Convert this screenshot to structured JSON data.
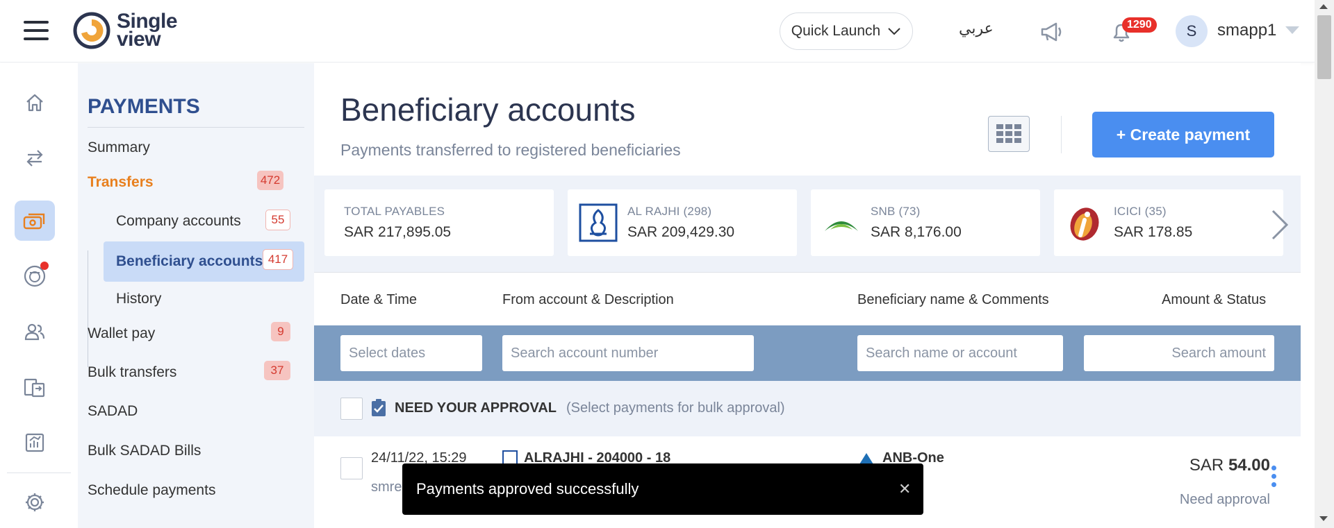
{
  "header": {
    "logo_line1": "Single",
    "logo_line2": "view",
    "quick_launch": "Quick Launch",
    "language": "عربي",
    "notifications_count": "1290",
    "avatar_initial": "S",
    "username": "smapp1"
  },
  "rail": {
    "items": [
      "home",
      "transfers",
      "payments",
      "savings",
      "users",
      "documents",
      "reports",
      "settings"
    ],
    "active": "payments"
  },
  "sidebar": {
    "title": "PAYMENTS",
    "summary": "Summary",
    "transfers": {
      "label": "Transfers",
      "badge": "472"
    },
    "company_accounts": {
      "label": "Company accounts",
      "badge": "55"
    },
    "beneficiary_accounts": {
      "label": "Beneficiary accounts",
      "badge": "417"
    },
    "history": "History",
    "wallet_pay": {
      "label": "Wallet pay",
      "badge": "9"
    },
    "bulk_transfers": {
      "label": "Bulk transfers",
      "badge": "37"
    },
    "sadad": "SADAD",
    "bulk_sadad": "Bulk SADAD Bills",
    "schedule_payments": "Schedule payments"
  },
  "main": {
    "title": "Beneficiary accounts",
    "subtitle": "Payments transferred to registered beneficiaries",
    "create_button": "+ Create payment"
  },
  "cards": [
    {
      "label": "TOTAL PAYABLES",
      "count": "",
      "value": "SAR 217,895.05",
      "logo": "none"
    },
    {
      "label": "AL RAJHI",
      "count": "(298)",
      "value": "SAR 209,429.30",
      "logo": "alrajhi-logo"
    },
    {
      "label": "SNB",
      "count": "(73)",
      "value": "SAR 8,176.00",
      "logo": "snb-logo"
    },
    {
      "label": "ICICI",
      "count": "(35)",
      "value": "SAR 178.85",
      "logo": "icici-logo"
    }
  ],
  "columns": {
    "date": "Date & Time",
    "from": "From account & Description",
    "beneficiary": "Beneficiary name & Comments",
    "amount": "Amount & Status"
  },
  "filters": {
    "date_placeholder": "Select dates",
    "account_placeholder": "Search account number",
    "name_placeholder": "Search name or account",
    "amount_placeholder": "Search amount"
  },
  "approval": {
    "label": "NEED YOUR APPROVAL",
    "hint": "(Select payments for bulk approval)"
  },
  "row": {
    "datetime": "24/11/22, 15:29",
    "user": "smre",
    "from": "ALRAJHI - 204000 - 18",
    "beneficiary": "ANB-One",
    "currency": "SAR",
    "amount": "54.00",
    "status": "Need approval"
  },
  "toast": {
    "message": "Payments approved successfully",
    "close": "✕"
  }
}
